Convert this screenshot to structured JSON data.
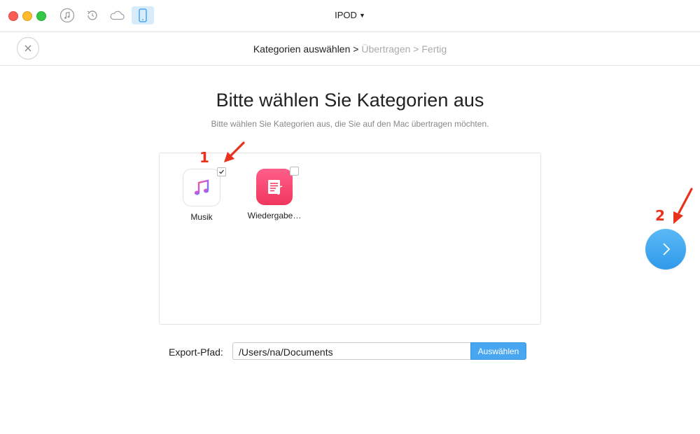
{
  "window": {
    "device_title": "IPOD",
    "toolbar_icons": [
      "music-note-icon",
      "restore-icon",
      "cloud-icon",
      "phone-icon"
    ]
  },
  "navbar": {
    "step_current": "Kategorien auswählen",
    "separator_1": " > ",
    "step_2": "Übertragen",
    "separator_2": " > ",
    "step_3": "Fertig"
  },
  "main": {
    "title": "Bitte wählen Sie Kategorien aus",
    "subtitle": "Bitte wählen Sie Kategorien aus, die Sie auf den Mac übertragen möchten.",
    "categories": [
      {
        "label": "Musik",
        "icon": "music-app-icon",
        "checked": true
      },
      {
        "label": "Wiedergabe…",
        "icon": "playlist-icon",
        "checked": false
      }
    ]
  },
  "export": {
    "label": "Export-Pfad:",
    "path_value": "/Users/na/Documents",
    "browse_label": "Auswählen"
  },
  "annotations": {
    "marker_1": "1",
    "marker_2": "2"
  },
  "colors": {
    "accent": "#48a7f0",
    "annotation": "#e8321c",
    "playlist_icon": "#f0365e"
  }
}
